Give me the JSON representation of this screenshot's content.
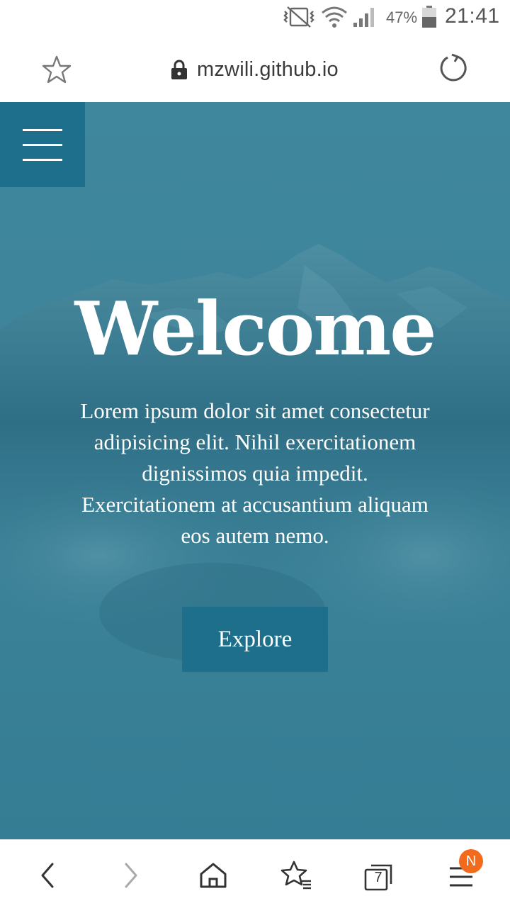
{
  "status_bar": {
    "battery_percent": "47%",
    "time": "21:41",
    "icons": [
      "mute-vibrate-icon",
      "wifi-icon",
      "signal-icon",
      "battery-icon"
    ]
  },
  "address_bar": {
    "url": "mzwili.github.io",
    "icons": [
      "star-icon",
      "lock-icon",
      "reload-icon"
    ]
  },
  "hero": {
    "title": "Welcome",
    "text": "Lorem ipsum dolor sit amet consectetur adipisicing elit. Nihil exercitationem dignissimos quia impedit. Exercitationem at accusantium aliquam eos autem nemo.",
    "button_label": "Explore",
    "colors": {
      "overlay": "#3b8198",
      "accent": "#1e6f8c",
      "text": "#ffffff"
    }
  },
  "bottom_nav": {
    "tab_count": "7",
    "badge": "N",
    "badge_color": "#f26b1d",
    "icons": [
      "back-icon",
      "forward-icon",
      "home-icon",
      "bookmarks-icon",
      "tabs-icon",
      "menu-icon"
    ]
  }
}
